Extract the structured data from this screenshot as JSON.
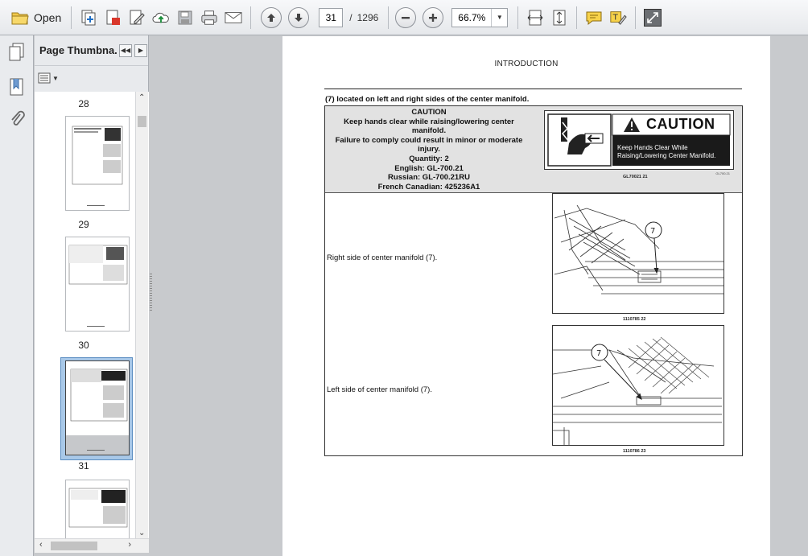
{
  "toolbar": {
    "open_label": "Open",
    "current_page": "31",
    "page_separator": "/",
    "total_pages": "1296",
    "zoom": "66.7%"
  },
  "thumbnails": {
    "panel_title": "Page Thumbna...",
    "pages": [
      "28",
      "29",
      "30",
      "31"
    ],
    "selected_page": "30"
  },
  "document": {
    "running_head": "INTRODUCTION",
    "lead_text": "(7) located on left and right sides of the center manifold.",
    "caution_block": [
      "CAUTION",
      "Keep hands clear while raising/lowering center",
      "manifold.",
      "Failure to comply could result in minor or moderate",
      "injury.",
      "Quantity:  2",
      "English:  GL-700.21",
      "Russian:  GL-700.21RU",
      "French Canadian:  425236A1"
    ],
    "decal": {
      "heading": "CAUTION",
      "message_line1": "Keep Hands Clear While",
      "message_line2": "Raising/Lowering Center Manifold.",
      "part_code": "GL700.21"
    },
    "figure1_caption": "GL70021     21",
    "row2_text": "Right side of center manifold (7).",
    "figure2_caption": "1110785     22",
    "figure2_callout": "7",
    "row3_text": "Left side of center manifold (7).",
    "figure3_caption": "1110786     23",
    "figure3_callout": "7"
  },
  "colors": {
    "toolbar_bg": "#e9ebee",
    "workspace_bg": "#c8cacd",
    "selection": "#a8c8e8"
  }
}
